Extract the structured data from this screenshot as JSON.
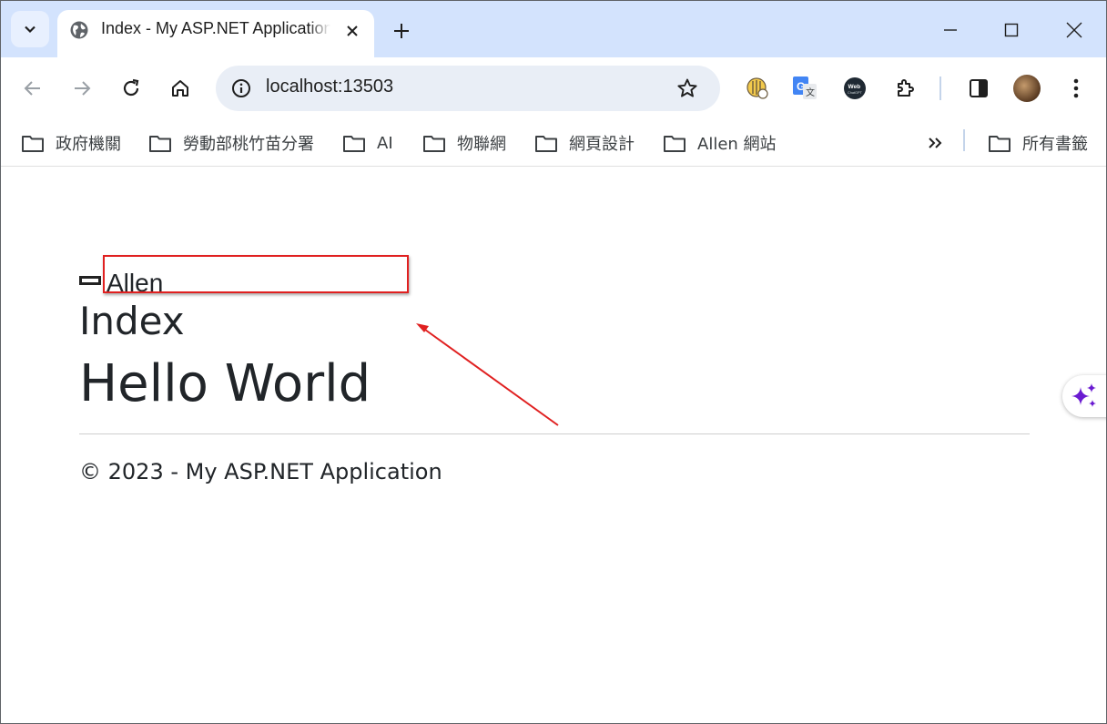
{
  "browser": {
    "tab_title": "Index - My ASP.NET Application",
    "url": "localhost:13503",
    "icons": [
      "tab-search-icon",
      "globe-icon",
      "close-icon",
      "plus-icon",
      "minimize-icon",
      "maximize-icon",
      "close-window-icon",
      "back-icon",
      "forward-icon",
      "reload-icon",
      "home-icon",
      "site-info-icon",
      "star-icon",
      "extension-icon",
      "google-translate-icon",
      "webchatgpt-icon",
      "puzzle-icon",
      "side-panel-icon",
      "profile-avatar",
      "more-vert-icon",
      "sparkle-icon"
    ]
  },
  "bookmarks": {
    "items": [
      {
        "label": "政府機關"
      },
      {
        "label": "勞動部桃竹苗分署"
      },
      {
        "label": "AI"
      },
      {
        "label": "物聯網"
      },
      {
        "label": "網頁設計"
      },
      {
        "label": "Allen 網站"
      }
    ],
    "all_label": "所有書籤"
  },
  "page": {
    "brand": "Allen",
    "heading": "Index",
    "hello": "Hello World",
    "footer": "© 2023 - My ASP.NET Application"
  },
  "colors": {
    "tabstrip": "#d3e3fd",
    "omnibox": "#e9eef6",
    "annotation": "#e02020",
    "text": "#212529",
    "sparkle": "#6a1bd1"
  }
}
